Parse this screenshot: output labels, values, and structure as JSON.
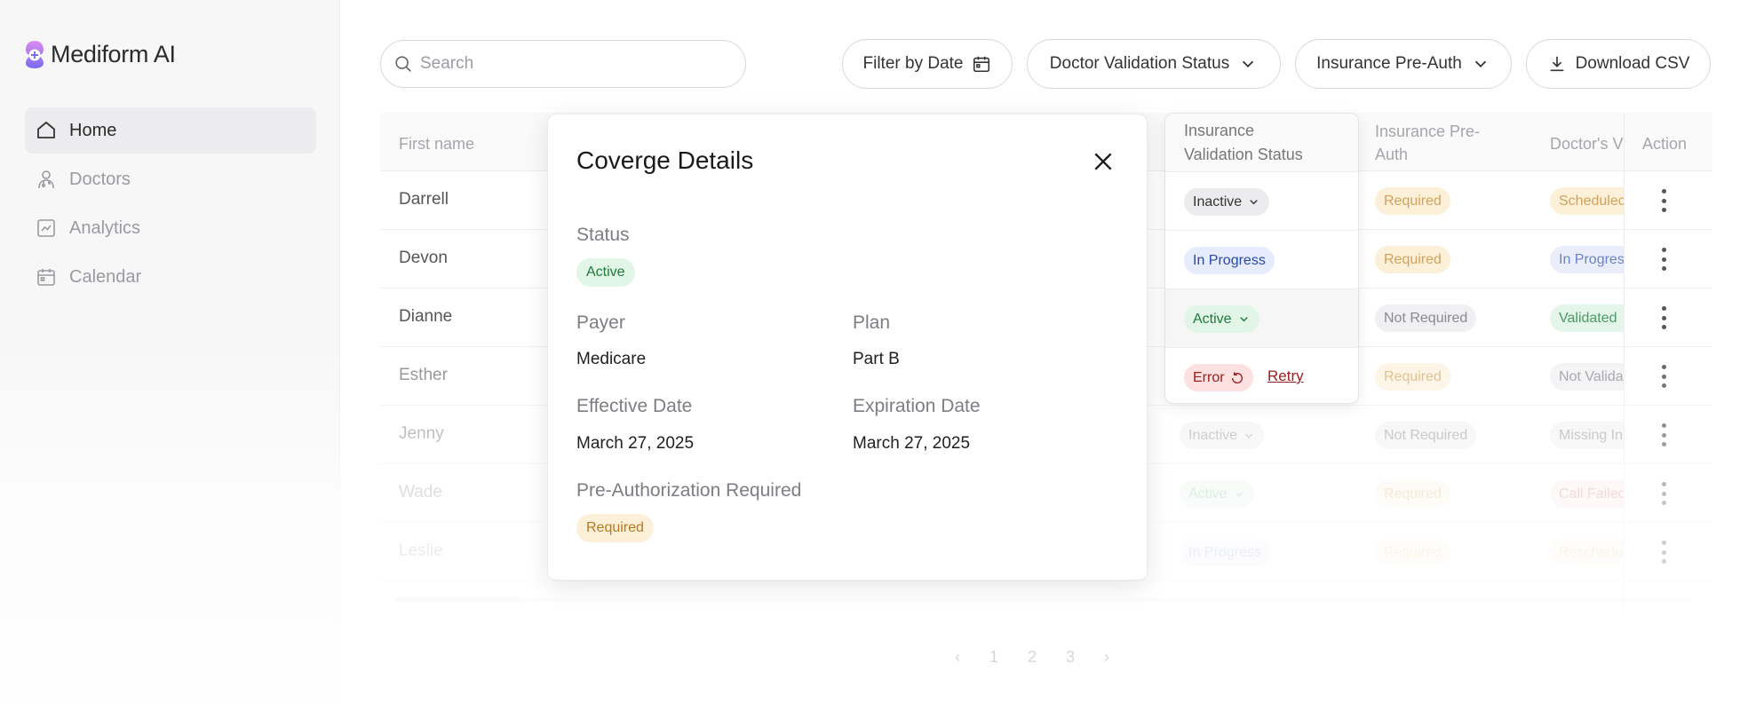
{
  "app": {
    "name": "Mediform AI"
  },
  "colors": {
    "accent": "#7c6cf0",
    "active_bg": "#e2f6e8",
    "active_fg": "#1f7a3a",
    "required_bg": "#fdf0d8",
    "required_fg": "#b7791f",
    "progress_bg": "#e6ecfb",
    "progress_fg": "#2a47a8",
    "error_bg": "#fde0e0",
    "error_fg": "#9b1c1c"
  },
  "sidebar": {
    "items": [
      {
        "label": "Home",
        "icon": "home-icon"
      },
      {
        "label": "Doctors",
        "icon": "doctor-icon"
      },
      {
        "label": "Analytics",
        "icon": "analytics-icon"
      },
      {
        "label": "Calendar",
        "icon": "calendar-icon"
      }
    ]
  },
  "toolbar": {
    "search_placeholder": "Search",
    "filter_date": "Filter by Date",
    "doctor_status": "Doctor Validation Status",
    "insurance_preauth": "Insurance Pre-Auth",
    "download": "Download CSV"
  },
  "table": {
    "headers": {
      "first_name": "First name",
      "insurance_validation_1": "Insurance",
      "insurance_validation_2": "Validation Status",
      "preauth_1": "Insurance Pre-",
      "preauth_2": "Auth",
      "doctor_validation": "Doctor's V",
      "action": "Action"
    },
    "rows": [
      {
        "first_name": "Darrell",
        "insurance": "Inactive",
        "preauth": "Required",
        "doctor": "Schedulec"
      },
      {
        "first_name": "Devon",
        "insurance": "In Progress",
        "preauth": "Required",
        "doctor": "In Progres"
      },
      {
        "first_name": "Dianne",
        "insurance": "Active",
        "preauth": "Not Required",
        "doctor": "Validated"
      },
      {
        "first_name": "Esther",
        "insurance": "Error",
        "preauth": "Required",
        "doctor": "Not Valida"
      },
      {
        "first_name": "Jenny",
        "insurance": "Inactive",
        "preauth": "Not Required",
        "doctor": "Missing In"
      },
      {
        "first_name": "Wade",
        "insurance": "Active",
        "preauth": "Required",
        "doctor": "Call Failed"
      },
      {
        "first_name": "Leslie",
        "insurance": "In Progress",
        "preauth": "Required",
        "doctor": "Reschedu"
      }
    ],
    "retry_label": "Retry"
  },
  "pagination": {
    "prev": "‹",
    "pages": [
      "1",
      "2",
      "3"
    ],
    "next": "›"
  },
  "modal": {
    "title": "Coverge Details",
    "status_label": "Status",
    "status_value": "Active",
    "payer_label": "Payer",
    "payer_value": "Medicare",
    "plan_label": "Plan",
    "plan_value": "Part B",
    "effective_label": "Effective Date",
    "effective_value": "March 27, 2025",
    "expiration_label": "Expiration Date",
    "expiration_value": "March 27, 2025",
    "preauth_label": "Pre-Authorization Required",
    "preauth_value": "Required"
  }
}
